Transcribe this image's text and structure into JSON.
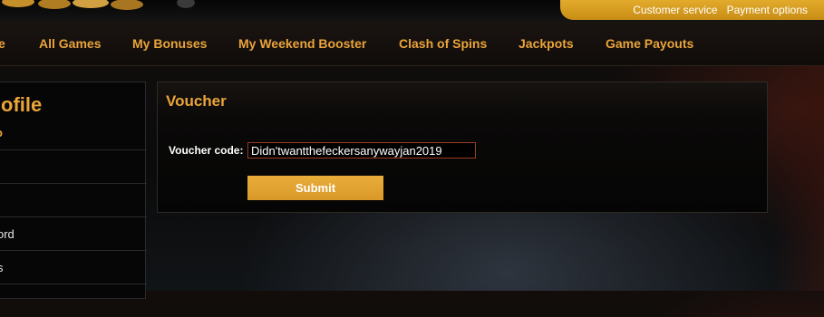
{
  "header": {
    "top_links": [
      "Customer service",
      "Payment options"
    ]
  },
  "nav": {
    "items": [
      "e",
      "All Games",
      "My Bonuses",
      "My Weekend Booster",
      "Clash of Spins",
      "Jackpots",
      "Game Payouts"
    ]
  },
  "sidebar": {
    "title": "ofile",
    "subtitle": "o",
    "items": [
      "",
      "",
      "ord",
      "s"
    ]
  },
  "voucher": {
    "title": "Voucher",
    "code_label": "Voucher code:",
    "code_value": "Didn'twantthefeckersanywayjan2019",
    "submit_label": "Submit"
  },
  "colors": {
    "accent": "#eaa43a",
    "button": "#e2a333",
    "input_border": "#9a3b1f"
  }
}
